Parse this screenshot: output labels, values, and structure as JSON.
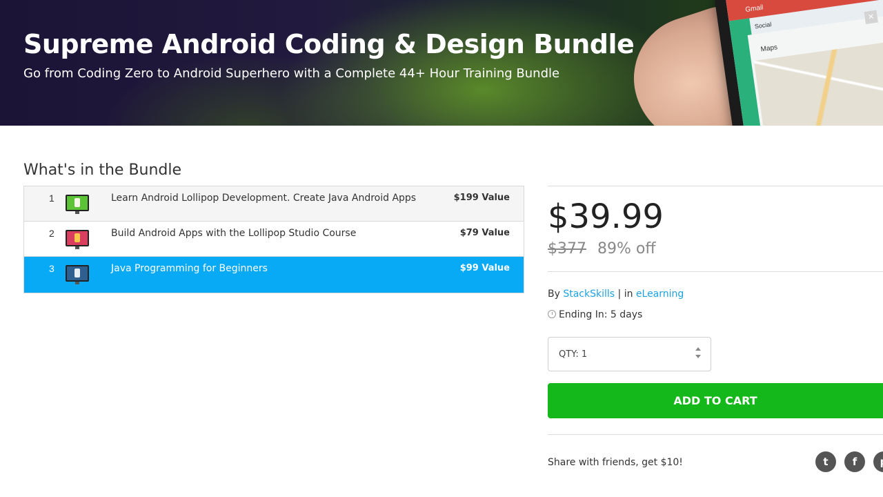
{
  "hero": {
    "title": "Supreme Android Coding & Design Bundle",
    "subtitle": "Go from Coding Zero to Android Superhero with a Complete 44+ Hour Training Bundle",
    "phone": {
      "gmail_label": "Gmail",
      "social_label": "Social",
      "maps_label": "Maps"
    }
  },
  "bundle": {
    "heading": "What's in the Bundle",
    "items": [
      {
        "num": "1",
        "title": "Learn Android Lollipop Development. Create Java Android Apps",
        "value": "$199 Value",
        "icon": "android-course-icon",
        "icon_color": "#5cc236",
        "selected": false
      },
      {
        "num": "2",
        "title": "Build Android Apps with the Lollipop Studio Course",
        "value": "$79 Value",
        "icon": "android-studio-course-icon",
        "icon_color": "#d93e5e",
        "selected": false
      },
      {
        "num": "3",
        "title": "Java Programming for Beginners",
        "value": "$99 Value",
        "icon": "java-course-icon",
        "icon_color": "#2f5f8f",
        "selected": true
      }
    ]
  },
  "pricing": {
    "current": "$39.99",
    "original": "$377",
    "discount": "89% off"
  },
  "meta": {
    "by_label": "By",
    "vendor": "StackSkills",
    "separator": "|",
    "in_label": "in",
    "category": "eLearning",
    "ending": "Ending In: 5 days"
  },
  "cart": {
    "qty_label": "QTY: 1",
    "add_button": "ADD TO CART"
  },
  "share": {
    "text": "Share with friends, get $10!",
    "buttons": [
      {
        "name": "twitter-icon",
        "glyph": "t"
      },
      {
        "name": "facebook-icon",
        "glyph": "f"
      },
      {
        "name": "pinterest-icon",
        "glyph": "p"
      }
    ]
  },
  "colors": {
    "accent_blue": "#08aaf5",
    "cart_green": "#15b81a",
    "link_blue": "#1da1e0"
  }
}
